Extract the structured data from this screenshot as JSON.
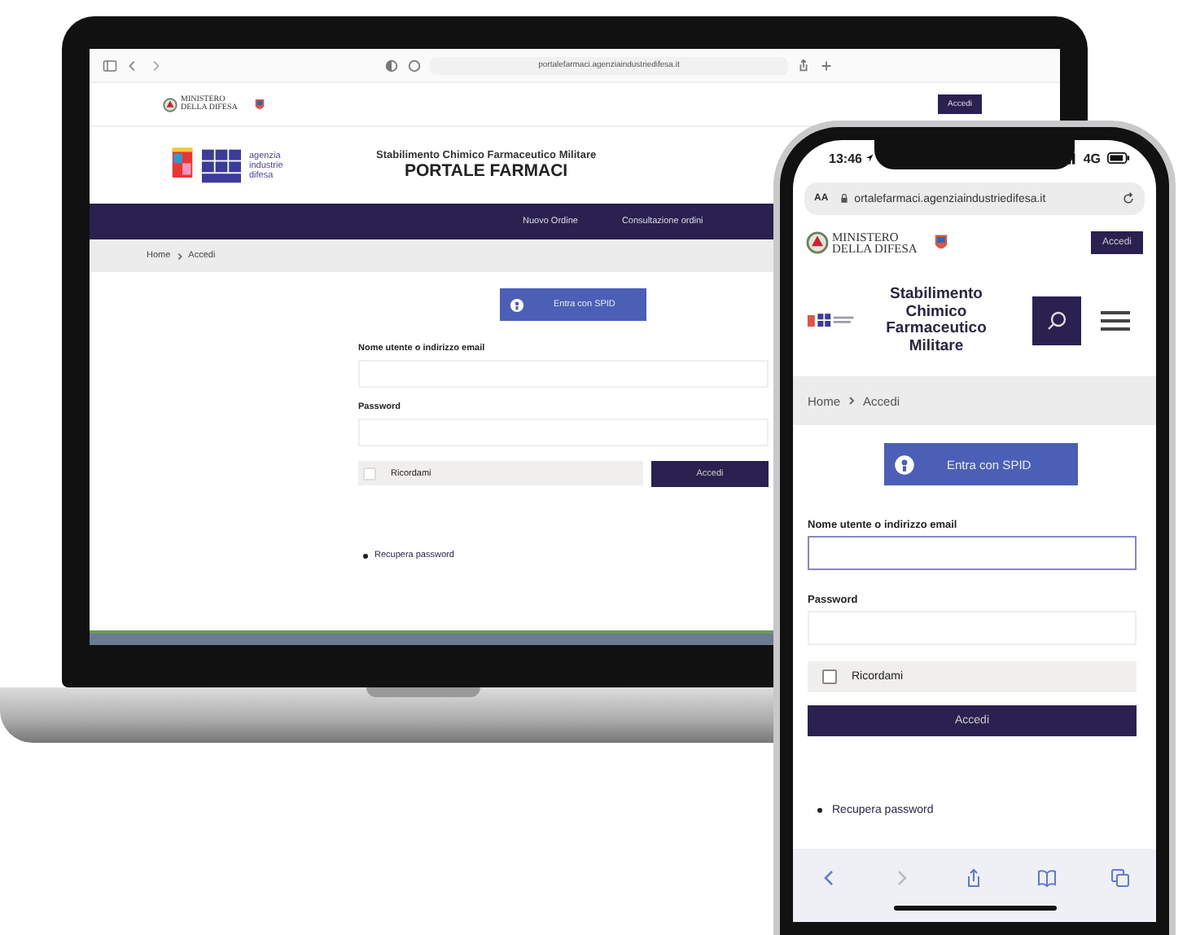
{
  "laptop": {
    "browser": {
      "url": "portalefarmaci.agenziaindustriedifesa.it"
    },
    "top_bar": {
      "ministry": [
        "MINISTERO",
        "DELLA DIFESA"
      ],
      "login_button": "Accedi"
    },
    "header": {
      "agency": [
        "agenzia",
        "industrie",
        "difesa"
      ],
      "subtitle": "Stabilimento Chimico Farmaceutico Militare",
      "title": "PORTALE FARMACI"
    },
    "nav": [
      {
        "label": "Nuovo Ordine"
      },
      {
        "label": "Consultazione ordini"
      }
    ],
    "breadcrumb": [
      "Home",
      "Accedi"
    ],
    "spid_button": "Entra con SPID",
    "form": {
      "fields": [
        {
          "label": "Nome utente o indirizzo email",
          "focused": false
        },
        {
          "label": "Password",
          "focused": false
        }
      ],
      "remember": {
        "label": "Ricordami",
        "checked": false
      },
      "submit": "Accedi"
    },
    "link": "Recupera password"
  },
  "phone": {
    "status": {
      "time": "13:46",
      "network": "4G"
    },
    "browser": {
      "text_size": "AA",
      "url": "ortalefarmaci.agenziaindustriedifesa.it"
    },
    "top_bar": {
      "ministry": [
        "MINISTERO",
        "DELLA DIFESA"
      ],
      "login_button": "Accedi"
    },
    "header": {
      "title": "Stabilimento Chimico Farmaceutico Militare"
    },
    "breadcrumb": [
      "Home",
      "Accedi"
    ],
    "spid_button": "Entra con SPID",
    "form": {
      "fields": [
        {
          "label": "Nome utente o indirizzo email",
          "focused": true
        },
        {
          "label": "Password",
          "focused": false
        }
      ],
      "remember": {
        "label": "Ricordami",
        "checked": false
      },
      "submit": "Accedi"
    },
    "link": "Recupera password"
  }
}
